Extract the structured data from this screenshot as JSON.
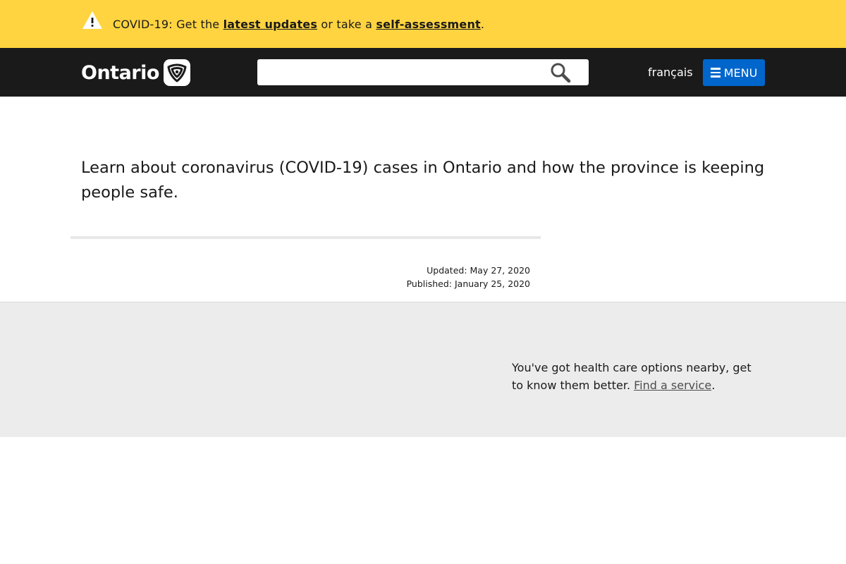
{
  "alert": {
    "icon": "warning-icon",
    "text_before": "COVID-19: Get the ",
    "link1": "latest updates",
    "text_middle": " or take a ",
    "link2": "self-assessment",
    "text_after": ".",
    "background": "#ffd440"
  },
  "header": {
    "logo_text": "Ontario",
    "logo_icon": "trillium-icon",
    "search": {
      "value": "",
      "placeholder": "",
      "icon": "search-icon"
    },
    "language_link": "français",
    "menu_button": {
      "label": "MENU",
      "icon": "hamburger-icon",
      "color": "#0066cc"
    },
    "background": "#1a1a1a"
  },
  "main": {
    "intro": "Learn about coronavirus (COVID-19) cases in Ontario and how the province is keeping people safe.",
    "updated": "Updated: May 27, 2020",
    "published": "Published: January 25, 2020"
  },
  "footer_band": {
    "text": "You've got health care options nearby, get to know them better. ",
    "link": "Find a service",
    "text_after": ".",
    "background": "#ececec"
  }
}
